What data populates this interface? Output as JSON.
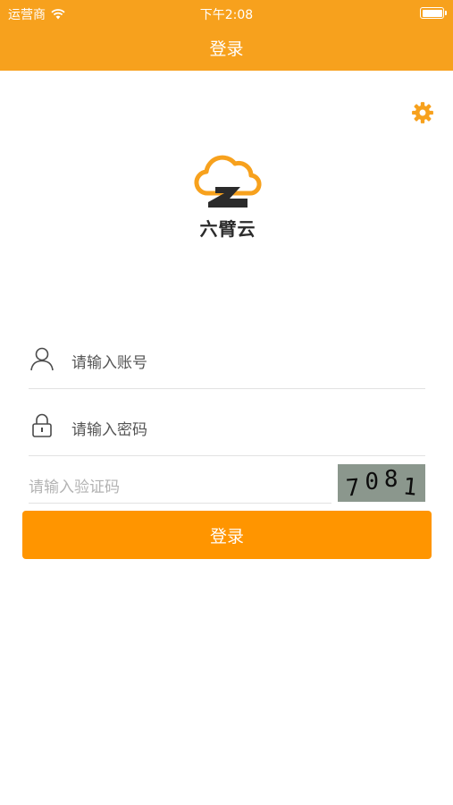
{
  "status_bar": {
    "carrier": "运营商",
    "time": "下午2:08"
  },
  "nav": {
    "title": "登录"
  },
  "settings": {
    "icon": "gear-icon"
  },
  "logo": {
    "text": "六臂云",
    "icon": "cloud-logo"
  },
  "form": {
    "username": {
      "placeholder": "请输入账号",
      "value": "",
      "icon": "user-icon"
    },
    "password": {
      "placeholder": "请输入密码",
      "value": "",
      "icon": "lock-icon"
    },
    "verify_code": {
      "placeholder": "请输入验证码",
      "value": ""
    },
    "captcha_digits": [
      "7",
      "0",
      "8",
      "1"
    ],
    "login_label": "登录"
  },
  "colors": {
    "nav_bg": "#f7a11d",
    "button_bg": "#ff9500",
    "captcha_bg": "#8b978d"
  }
}
